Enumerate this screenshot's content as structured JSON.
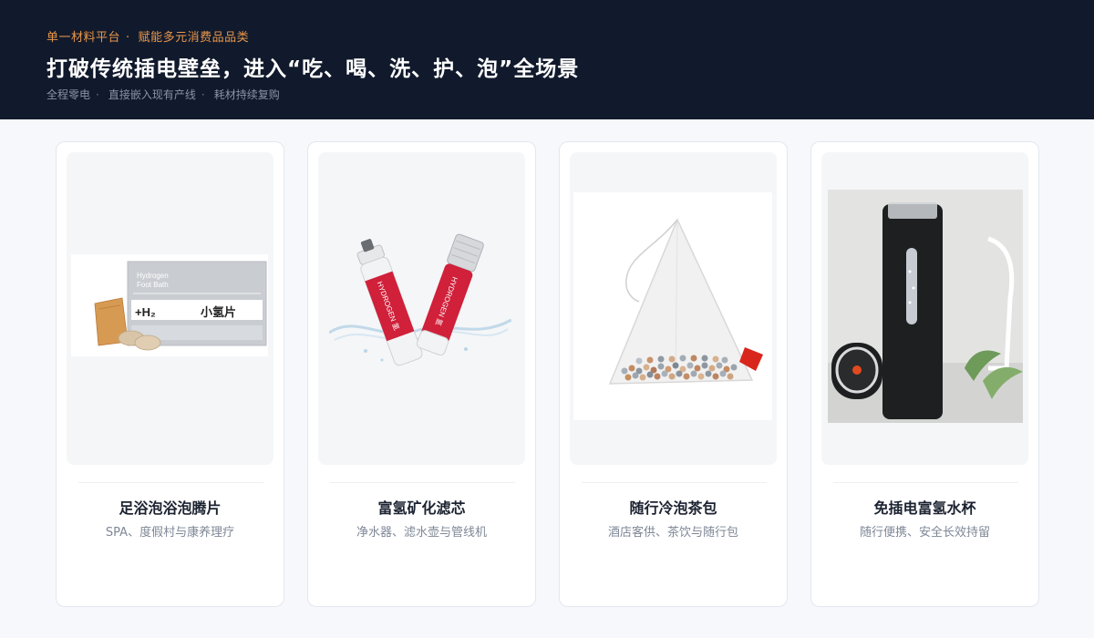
{
  "header": {
    "eyebrow_left": "单一材料平台",
    "eyebrow_sep": "·",
    "eyebrow_right": "赋能多元消费品品类",
    "headline": "打破传统插电壁垒，进入“吃、喝、洗、护、泡”全场景",
    "tags": [
      "全程零电",
      "直接嵌入现有产线",
      "耗材持续复购"
    ],
    "tag_sep": "·"
  },
  "products": [
    {
      "title": "足浴泡浴泡腾片",
      "subtitle": "SPA、度假村与康养理疗",
      "image": "hydrogen-foot-bath-box",
      "box_text": {
        "brand_line1": "Hydrogen",
        "brand_line2": "Foot Bath",
        "formula": "+H₂",
        "name": "小氢片"
      }
    },
    {
      "title": "富氢矿化滤芯",
      "subtitle": "净水器、滤水壶与管线机",
      "image": "hydrogen-filter-cartridges",
      "cartridge_text": "HYDROGEN 氢"
    },
    {
      "title": "随行冷泡茶包",
      "subtitle": "酒店客供、茶饮与随行包",
      "image": "mineral-tea-bag"
    },
    {
      "title": "免插电富氢水杯",
      "subtitle": "随行便携、安全长效持留",
      "image": "hydrogen-water-bottle"
    }
  ],
  "colors": {
    "header_bg": "#111a2c",
    "accent": "#e9964b",
    "page_bg": "#f6f8fb",
    "cartridge_red": "#d0203a"
  }
}
